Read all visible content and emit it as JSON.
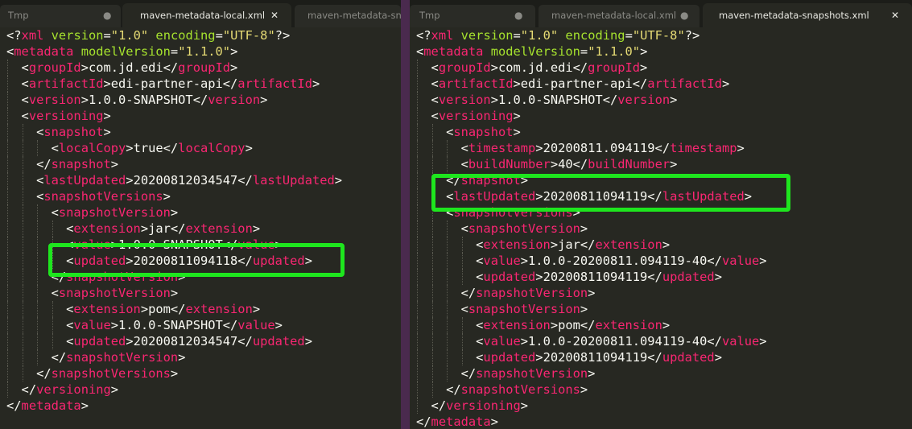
{
  "left_pane": {
    "tabs": [
      {
        "label": "Tmp",
        "icon": "dot-icon",
        "state": "inactive"
      },
      {
        "label": "maven-metadata-local.xml",
        "icon": "close-icon",
        "state": "active"
      },
      {
        "label": "maven-metadata-sn",
        "state": "inactive"
      }
    ],
    "lines": [
      {
        "indent": 0,
        "tokens": [
          [
            "p",
            "<?"
          ],
          [
            "t",
            "xml"
          ],
          [
            "p",
            " "
          ],
          [
            "a",
            "version"
          ],
          [
            "p",
            "="
          ],
          [
            "s",
            "\"1.0\""
          ],
          [
            "p",
            " "
          ],
          [
            "a",
            "encoding"
          ],
          [
            "p",
            "="
          ],
          [
            "s",
            "\"UTF-8\""
          ],
          [
            "p",
            "?>"
          ]
        ]
      },
      {
        "indent": 0,
        "tokens": [
          [
            "p",
            "<"
          ],
          [
            "t",
            "metadata"
          ],
          [
            "p",
            " "
          ],
          [
            "a",
            "modelVersion"
          ],
          [
            "p",
            "="
          ],
          [
            "s",
            "\"1.1.0\""
          ],
          [
            "p",
            ">"
          ]
        ]
      },
      {
        "indent": 1,
        "tokens": [
          [
            "p",
            "<"
          ],
          [
            "t",
            "groupId"
          ],
          [
            "p",
            ">com.jd.edi</"
          ],
          [
            "t",
            "groupId"
          ],
          [
            "p",
            ">"
          ]
        ]
      },
      {
        "indent": 1,
        "tokens": [
          [
            "p",
            "<"
          ],
          [
            "t",
            "artifactId"
          ],
          [
            "p",
            ">edi-partner-api</"
          ],
          [
            "t",
            "artifactId"
          ],
          [
            "p",
            ">"
          ]
        ]
      },
      {
        "indent": 1,
        "tokens": [
          [
            "p",
            "<"
          ],
          [
            "t",
            "version"
          ],
          [
            "p",
            ">1.0.0-SNAPSHOT</"
          ],
          [
            "t",
            "version"
          ],
          [
            "p",
            ">"
          ]
        ]
      },
      {
        "indent": 1,
        "tokens": [
          [
            "p",
            "<"
          ],
          [
            "t",
            "versioning"
          ],
          [
            "p",
            ">"
          ]
        ]
      },
      {
        "indent": 2,
        "tokens": [
          [
            "p",
            "<"
          ],
          [
            "t",
            "snapshot"
          ],
          [
            "p",
            ">"
          ]
        ]
      },
      {
        "indent": 3,
        "tokens": [
          [
            "p",
            "<"
          ],
          [
            "t",
            "localCopy"
          ],
          [
            "p",
            ">true</"
          ],
          [
            "t",
            "localCopy"
          ],
          [
            "p",
            ">"
          ]
        ]
      },
      {
        "indent": 2,
        "tokens": [
          [
            "p",
            "</"
          ],
          [
            "t",
            "snapshot"
          ],
          [
            "p",
            ">"
          ]
        ]
      },
      {
        "indent": 2,
        "tokens": [
          [
            "p",
            "<"
          ],
          [
            "t",
            "lastUpdated"
          ],
          [
            "p",
            ">20200812034547</"
          ],
          [
            "t",
            "lastUpdated"
          ],
          [
            "p",
            ">"
          ]
        ]
      },
      {
        "indent": 2,
        "tokens": [
          [
            "p",
            "<"
          ],
          [
            "t",
            "snapshotVersions"
          ],
          [
            "p",
            ">"
          ]
        ]
      },
      {
        "indent": 3,
        "tokens": [
          [
            "p",
            "<"
          ],
          [
            "t",
            "snapshotVersion"
          ],
          [
            "p",
            ">"
          ]
        ]
      },
      {
        "indent": 4,
        "tokens": [
          [
            "p",
            "<"
          ],
          [
            "t",
            "extension"
          ],
          [
            "p",
            ">jar</"
          ],
          [
            "t",
            "extension"
          ],
          [
            "p",
            ">"
          ]
        ]
      },
      {
        "indent": 4,
        "tokens": [
          [
            "p",
            "<"
          ],
          [
            "t",
            "value"
          ],
          [
            "p",
            ">1.0.0-SNAPSHOT</"
          ],
          [
            "t",
            "value"
          ],
          [
            "p",
            ">"
          ]
        ]
      },
      {
        "indent": 4,
        "tokens": [
          [
            "p",
            "<"
          ],
          [
            "t",
            "updated"
          ],
          [
            "p",
            ">20200811094118</"
          ],
          [
            "t",
            "updated"
          ],
          [
            "p",
            ">"
          ]
        ]
      },
      {
        "indent": 3,
        "tokens": [
          [
            "p",
            "</"
          ],
          [
            "t",
            "snapshotVersion"
          ],
          [
            "p",
            ">"
          ]
        ]
      },
      {
        "indent": 3,
        "tokens": [
          [
            "p",
            "<"
          ],
          [
            "t",
            "snapshotVersion"
          ],
          [
            "p",
            ">"
          ]
        ]
      },
      {
        "indent": 4,
        "tokens": [
          [
            "p",
            "<"
          ],
          [
            "t",
            "extension"
          ],
          [
            "p",
            ">pom</"
          ],
          [
            "t",
            "extension"
          ],
          [
            "p",
            ">"
          ]
        ]
      },
      {
        "indent": 4,
        "tokens": [
          [
            "p",
            "<"
          ],
          [
            "t",
            "value"
          ],
          [
            "p",
            ">1.0.0-SNAPSHOT</"
          ],
          [
            "t",
            "value"
          ],
          [
            "p",
            ">"
          ]
        ]
      },
      {
        "indent": 4,
        "tokens": [
          [
            "p",
            "<"
          ],
          [
            "t",
            "updated"
          ],
          [
            "p",
            ">20200812034547</"
          ],
          [
            "t",
            "updated"
          ],
          [
            "p",
            ">"
          ]
        ]
      },
      {
        "indent": 3,
        "tokens": [
          [
            "p",
            "</"
          ],
          [
            "t",
            "snapshotVersion"
          ],
          [
            "p",
            ">"
          ]
        ]
      },
      {
        "indent": 2,
        "tokens": [
          [
            "p",
            "</"
          ],
          [
            "t",
            "snapshotVersions"
          ],
          [
            "p",
            ">"
          ]
        ]
      },
      {
        "indent": 1,
        "tokens": [
          [
            "p",
            "</"
          ],
          [
            "t",
            "versioning"
          ],
          [
            "p",
            ">"
          ]
        ]
      },
      {
        "indent": 0,
        "tokens": [
          [
            "p",
            "</"
          ],
          [
            "t",
            "metadata"
          ],
          [
            "p",
            ">"
          ]
        ]
      }
    ]
  },
  "right_pane": {
    "tabs": [
      {
        "label": "Tmp",
        "icon": "dot-icon",
        "state": "inactive"
      },
      {
        "label": "maven-metadata-local.xml",
        "icon": "dot-icon",
        "state": "inactive"
      },
      {
        "label": "maven-metadata-snapshots.xml",
        "icon": "close-icon",
        "state": "active"
      }
    ],
    "lines": [
      {
        "indent": 0,
        "tokens": [
          [
            "p",
            "<?"
          ],
          [
            "t",
            "xml"
          ],
          [
            "p",
            " "
          ],
          [
            "a",
            "version"
          ],
          [
            "p",
            "="
          ],
          [
            "s",
            "\"1.0\""
          ],
          [
            "p",
            " "
          ],
          [
            "a",
            "encoding"
          ],
          [
            "p",
            "="
          ],
          [
            "s",
            "\"UTF-8\""
          ],
          [
            "p",
            "?>"
          ]
        ]
      },
      {
        "indent": 0,
        "tokens": [
          [
            "p",
            "<"
          ],
          [
            "t",
            "metadata"
          ],
          [
            "p",
            " "
          ],
          [
            "a",
            "modelVersion"
          ],
          [
            "p",
            "="
          ],
          [
            "s",
            "\"1.1.0\""
          ],
          [
            "p",
            ">"
          ]
        ]
      },
      {
        "indent": 1,
        "tokens": [
          [
            "p",
            "<"
          ],
          [
            "t",
            "groupId"
          ],
          [
            "p",
            ">com.jd.edi</"
          ],
          [
            "t",
            "groupId"
          ],
          [
            "p",
            ">"
          ]
        ]
      },
      {
        "indent": 1,
        "tokens": [
          [
            "p",
            "<"
          ],
          [
            "t",
            "artifactId"
          ],
          [
            "p",
            ">edi-partner-api</"
          ],
          [
            "t",
            "artifactId"
          ],
          [
            "p",
            ">"
          ]
        ]
      },
      {
        "indent": 1,
        "tokens": [
          [
            "p",
            "<"
          ],
          [
            "t",
            "version"
          ],
          [
            "p",
            ">1.0.0-SNAPSHOT</"
          ],
          [
            "t",
            "version"
          ],
          [
            "p",
            ">"
          ]
        ]
      },
      {
        "indent": 1,
        "tokens": [
          [
            "p",
            "<"
          ],
          [
            "t",
            "versioning"
          ],
          [
            "p",
            ">"
          ]
        ]
      },
      {
        "indent": 2,
        "tokens": [
          [
            "p",
            "<"
          ],
          [
            "t",
            "snapshot"
          ],
          [
            "p",
            ">"
          ]
        ]
      },
      {
        "indent": 3,
        "tokens": [
          [
            "p",
            "<"
          ],
          [
            "t",
            "timestamp"
          ],
          [
            "p",
            ">20200811.094119</"
          ],
          [
            "t",
            "timestamp"
          ],
          [
            "p",
            ">"
          ]
        ]
      },
      {
        "indent": 3,
        "tokens": [
          [
            "p",
            "<"
          ],
          [
            "t",
            "buildNumber"
          ],
          [
            "p",
            ">40</"
          ],
          [
            "t",
            "buildNumber"
          ],
          [
            "p",
            ">"
          ]
        ]
      },
      {
        "indent": 2,
        "tokens": [
          [
            "p",
            "</"
          ],
          [
            "t",
            "snapshot"
          ],
          [
            "p",
            ">"
          ]
        ]
      },
      {
        "indent": 2,
        "tokens": [
          [
            "p",
            "<"
          ],
          [
            "t",
            "lastUpdated"
          ],
          [
            "p",
            ">20200811094119</"
          ],
          [
            "t",
            "lastUpdated"
          ],
          [
            "p",
            ">"
          ]
        ]
      },
      {
        "indent": 2,
        "tokens": [
          [
            "p",
            "<"
          ],
          [
            "t",
            "snapshotVersions"
          ],
          [
            "p",
            ">"
          ]
        ]
      },
      {
        "indent": 3,
        "tokens": [
          [
            "p",
            "<"
          ],
          [
            "t",
            "snapshotVersion"
          ],
          [
            "p",
            ">"
          ]
        ]
      },
      {
        "indent": 4,
        "tokens": [
          [
            "p",
            "<"
          ],
          [
            "t",
            "extension"
          ],
          [
            "p",
            ">jar</"
          ],
          [
            "t",
            "extension"
          ],
          [
            "p",
            ">"
          ]
        ]
      },
      {
        "indent": 4,
        "tokens": [
          [
            "p",
            "<"
          ],
          [
            "t",
            "value"
          ],
          [
            "p",
            ">1.0.0-20200811.094119-40</"
          ],
          [
            "t",
            "value"
          ],
          [
            "p",
            ">"
          ]
        ]
      },
      {
        "indent": 4,
        "tokens": [
          [
            "p",
            "<"
          ],
          [
            "t",
            "updated"
          ],
          [
            "p",
            ">20200811094119</"
          ],
          [
            "t",
            "updated"
          ],
          [
            "p",
            ">"
          ]
        ]
      },
      {
        "indent": 3,
        "tokens": [
          [
            "p",
            "</"
          ],
          [
            "t",
            "snapshotVersion"
          ],
          [
            "p",
            ">"
          ]
        ]
      },
      {
        "indent": 3,
        "tokens": [
          [
            "p",
            "<"
          ],
          [
            "t",
            "snapshotVersion"
          ],
          [
            "p",
            ">"
          ]
        ]
      },
      {
        "indent": 4,
        "tokens": [
          [
            "p",
            "<"
          ],
          [
            "t",
            "extension"
          ],
          [
            "p",
            ">pom</"
          ],
          [
            "t",
            "extension"
          ],
          [
            "p",
            ">"
          ]
        ]
      },
      {
        "indent": 4,
        "tokens": [
          [
            "p",
            "<"
          ],
          [
            "t",
            "value"
          ],
          [
            "p",
            ">1.0.0-20200811.094119-40</"
          ],
          [
            "t",
            "value"
          ],
          [
            "p",
            ">"
          ]
        ]
      },
      {
        "indent": 4,
        "tokens": [
          [
            "p",
            "<"
          ],
          [
            "t",
            "updated"
          ],
          [
            "p",
            ">20200811094119</"
          ],
          [
            "t",
            "updated"
          ],
          [
            "p",
            ">"
          ]
        ]
      },
      {
        "indent": 3,
        "tokens": [
          [
            "p",
            "</"
          ],
          [
            "t",
            "snapshotVersion"
          ],
          [
            "p",
            ">"
          ]
        ]
      },
      {
        "indent": 2,
        "tokens": [
          [
            "p",
            "</"
          ],
          [
            "t",
            "snapshotVersions"
          ],
          [
            "p",
            ">"
          ]
        ]
      },
      {
        "indent": 1,
        "tokens": [
          [
            "p",
            "</"
          ],
          [
            "t",
            "versioning"
          ],
          [
            "p",
            ">"
          ]
        ]
      },
      {
        "indent": 0,
        "tokens": [
          [
            "p",
            "</"
          ],
          [
            "t",
            "metadata"
          ],
          [
            "p",
            ">"
          ]
        ]
      }
    ]
  },
  "highlights": {
    "color": "#1ee61e"
  },
  "syntax_colors": {
    "tag": "#f92672",
    "attribute": "#a6e22e",
    "string": "#e6db74",
    "text": "#f8f8f2",
    "background": "#272822"
  }
}
